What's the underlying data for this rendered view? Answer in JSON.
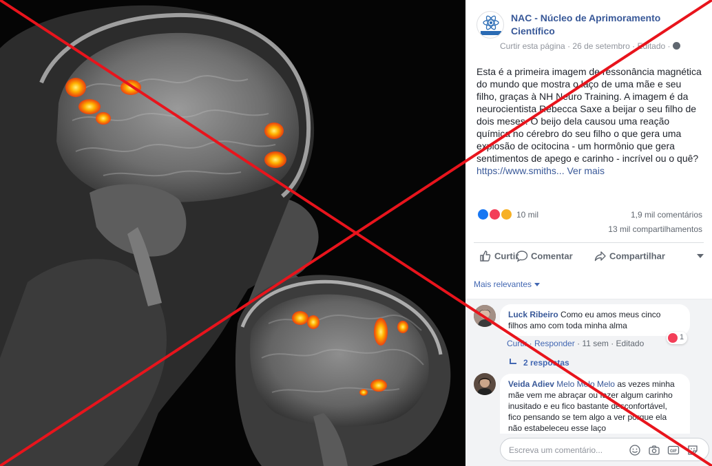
{
  "page": {
    "name": "NAC - Núcleo de Aprimoramento Científico",
    "logo_text": "NACIENTIFICO",
    "like_page": "Curtir esta página",
    "date": "26 de setembro",
    "edited": "Editado",
    "separator": "·"
  },
  "post": {
    "text": "Esta é a primeira imagem de ressonância magnética do mundo que mostra o laço de uma mãe e seu filho, graças à NH Neuro Training. A imagem é da neurocientista Rebecca Saxe a beijar o seu filho de dois meses. O beijo dela causou uma reação química no cérebro do seu filho o que gera uma explosão de ocitocina - um hormônio que gera sentimentos de apego e carinho - incrível ou o quê?",
    "url": "https://www.smiths...",
    "see_more": "Ver mais"
  },
  "stats": {
    "reactions": "10 mil",
    "comments": "1,9 mil comentários",
    "shares": "13 mil compartilhamentos"
  },
  "actions": {
    "like": "Curtir",
    "comment": "Comentar",
    "share": "Compartilhar"
  },
  "sort": {
    "label": "Mais relevantes"
  },
  "comments": [
    {
      "author": "Luck Ribeiro",
      "text": "Como eu amos meus cinco filhos amo com toda minha alma",
      "like": "Curtir",
      "reply": "Responder",
      "time": "11 sem",
      "edited": "Editado",
      "reaction_count": "1",
      "replies": "2 respostas"
    },
    {
      "author": "Veida Adiev",
      "tag": "Melo Melo Melo",
      "text": "as vezes minha mãe vem me abraçar ou fazer algum carinho inusitado e eu fico bastante desconfortável, fico pensando se tem algo a ver porque ela não estabeleceu esse laço"
    }
  ],
  "composer": {
    "placeholder": "Escreva um comentário..."
  },
  "colors": {
    "link": "#385898",
    "accent": "#4267b2",
    "cross": "#e8141c",
    "mri_hot": "#ff6a00"
  }
}
